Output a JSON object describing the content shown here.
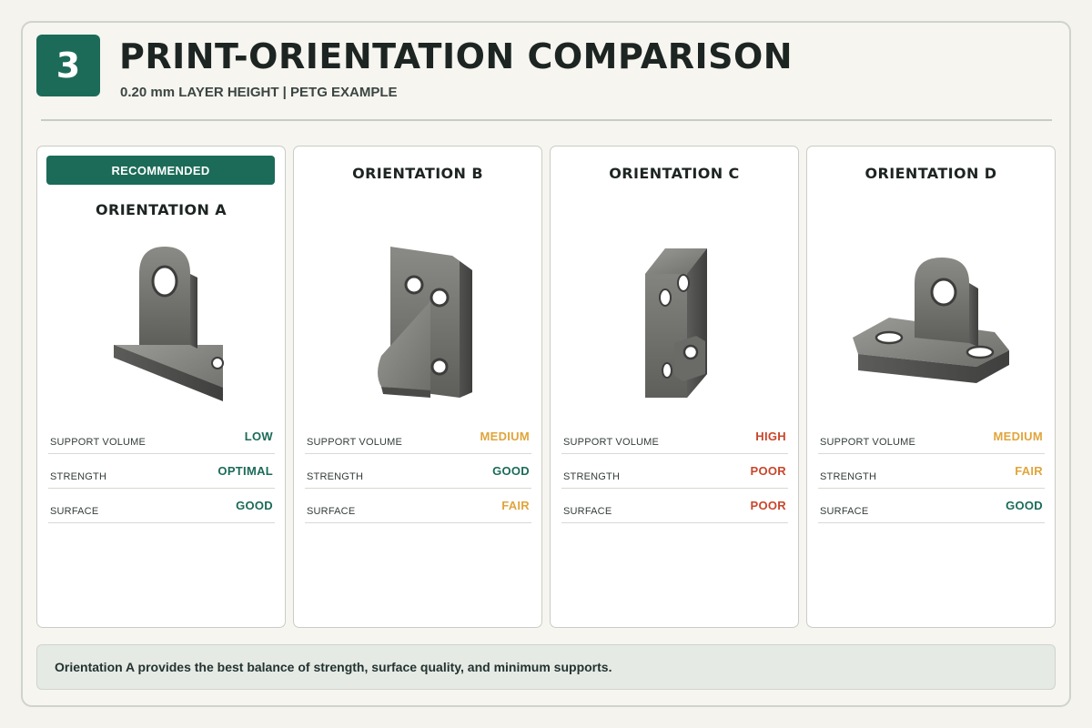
{
  "header": {
    "step_number": "3",
    "title": "PRINT-ORIENTATION COMPARISON",
    "subtitle": "0.20 mm LAYER HEIGHT | PETG EXAMPLE"
  },
  "colors": {
    "accent": "#1b6b58",
    "good": "#1b6b58",
    "medium": "#e0a53c",
    "poor": "#c9462c"
  },
  "cards": [
    {
      "badge": "RECOMMENDED",
      "title": "ORIENTATION A",
      "image": "bracket-lug-upright",
      "metrics": [
        {
          "label": "SUPPORT VOLUME",
          "value": "LOW",
          "color": "#1b6b58"
        },
        {
          "label": "STRENGTH",
          "value": "OPTIMAL",
          "color": "#1b6b58"
        },
        {
          "label": "SURFACE",
          "value": "GOOD",
          "color": "#1b6b58"
        }
      ]
    },
    {
      "title": "ORIENTATION B",
      "image": "bracket-plate-vertical",
      "metrics": [
        {
          "label": "SUPPORT VOLUME",
          "value": "MEDIUM",
          "color": "#e0a53c"
        },
        {
          "label": "STRENGTH",
          "value": "GOOD",
          "color": "#1b6b58"
        },
        {
          "label": "SURFACE",
          "value": "FAIR",
          "color": "#e0a53c"
        }
      ]
    },
    {
      "title": "ORIENTATION C",
      "image": "bracket-plate-edge",
      "metrics": [
        {
          "label": "SUPPORT VOLUME",
          "value": "HIGH",
          "color": "#c9462c"
        },
        {
          "label": "STRENGTH",
          "value": "POOR",
          "color": "#c9462c"
        },
        {
          "label": "SURFACE",
          "value": "POOR",
          "color": "#c9462c"
        }
      ]
    },
    {
      "title": "ORIENTATION D",
      "image": "bracket-flat-base",
      "metrics": [
        {
          "label": "SUPPORT VOLUME",
          "value": "MEDIUM",
          "color": "#e0a53c"
        },
        {
          "label": "STRENGTH",
          "value": "FAIR",
          "color": "#e0a53c"
        },
        {
          "label": "SURFACE",
          "value": "GOOD",
          "color": "#1b6b58"
        }
      ]
    }
  ],
  "footer": {
    "note": "Orientation A provides the best balance of strength, surface quality, and minimum supports."
  }
}
